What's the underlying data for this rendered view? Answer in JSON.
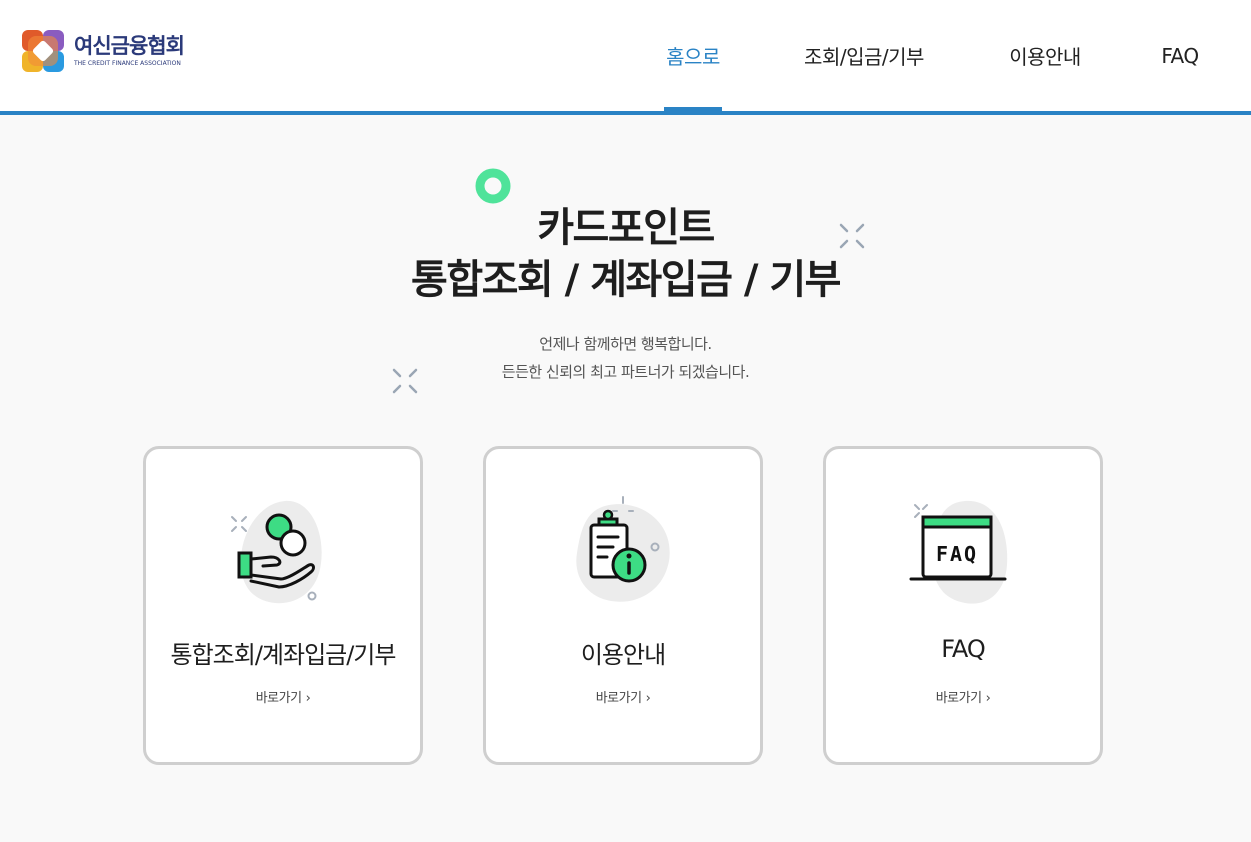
{
  "header": {
    "logo": {
      "name": "여신금융협회",
      "sub": "THE CREDIT FINANCE ASSOCIATION"
    },
    "nav": [
      {
        "label": "홈으로",
        "active": true
      },
      {
        "label": "조회/입금/기부",
        "active": false
      },
      {
        "label": "이용안내",
        "active": false
      },
      {
        "label": "FAQ",
        "active": false
      }
    ]
  },
  "hero": {
    "title_line1": "카드포인트",
    "title_line2": "통합조회 / 계좌입금 / 기부",
    "sub_line1": "언제나 함께하면 행복합니다.",
    "sub_line2": "든든한 신뢰의 최고 파트너가 되겠습니다."
  },
  "cards": [
    {
      "title": "통합조회/계좌입금/기부",
      "link": "바로가기",
      "icon": "coin-hand-icon"
    },
    {
      "title": "이용안내",
      "link": "바로가기",
      "icon": "clipboard-info-icon"
    },
    {
      "title": "FAQ",
      "link": "바로가기",
      "icon": "faq-window-icon",
      "icon_text": "FAQ"
    }
  ],
  "colors": {
    "accent": "#2a83c5",
    "green": "#3ddc84",
    "card_border": "#cfcfcf"
  }
}
